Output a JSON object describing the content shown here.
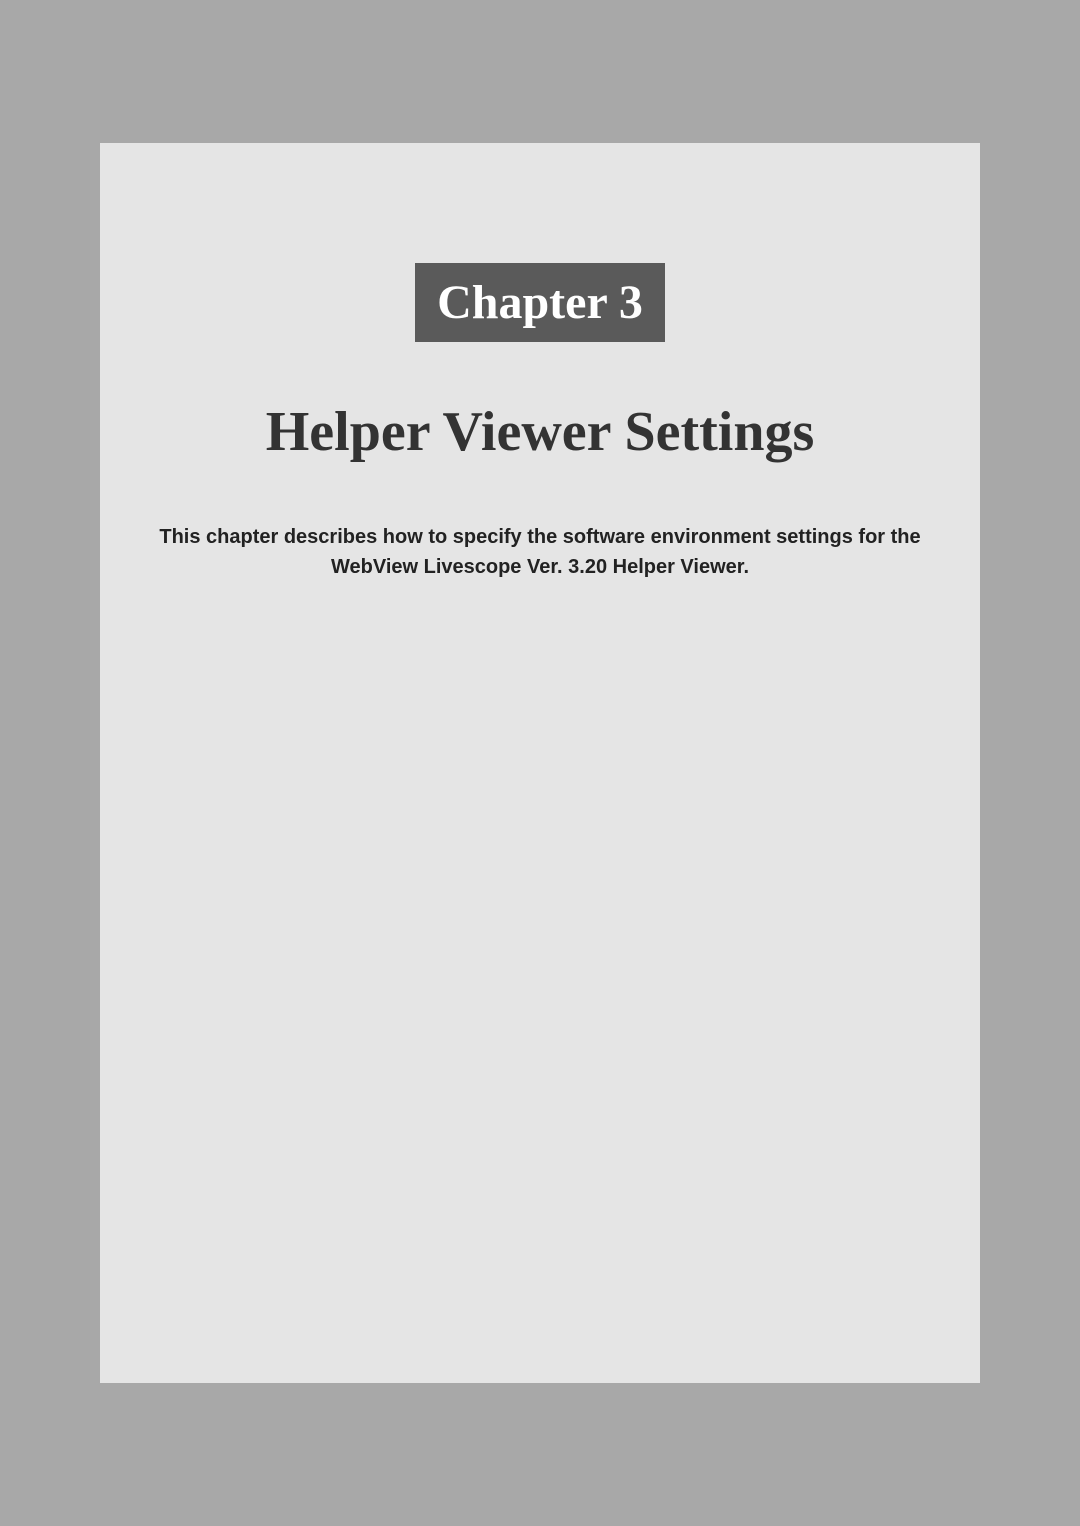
{
  "chapter": {
    "badge": "Chapter 3",
    "title": "Helper Viewer Settings",
    "description": "This chapter describes how to specify the software environment settings for the WebView Livescope Ver. 3.20 Helper Viewer."
  }
}
